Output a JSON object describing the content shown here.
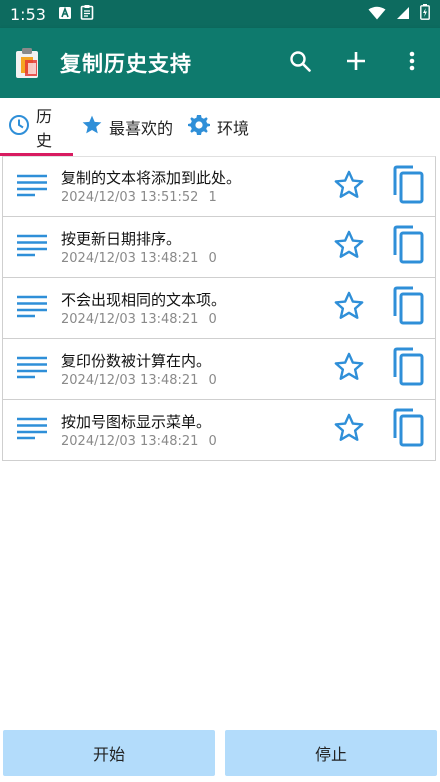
{
  "status_bar": {
    "time": "1:53",
    "left_icons": [
      "font-download-icon",
      "clipboard-icon"
    ],
    "right_icons": [
      "wifi-icon",
      "signal-icon",
      "battery-icon"
    ]
  },
  "app_bar": {
    "title": "复制历史支持",
    "actions": [
      "search-icon",
      "add-icon",
      "more-vert-icon"
    ]
  },
  "tabs": [
    {
      "label": "历史",
      "icon": "clock-icon",
      "active": true
    },
    {
      "label": "最喜欢的",
      "icon": "star-icon",
      "active": false
    },
    {
      "label": "环境",
      "icon": "gear-icon",
      "active": false
    }
  ],
  "items": [
    {
      "title": "复制的文本将添加到此处。",
      "date": "2024/12/03 13:51:52",
      "count": "1"
    },
    {
      "title": "按更新日期排序。",
      "date": "2024/12/03 13:48:21",
      "count": "0"
    },
    {
      "title": "不会出现相同的文本项。",
      "date": "2024/12/03 13:48:21",
      "count": "0"
    },
    {
      "title": "复印份数被计算在内。",
      "date": "2024/12/03 13:48:21",
      "count": "0"
    },
    {
      "title": "按加号图标显示菜单。",
      "date": "2024/12/03 13:48:21",
      "count": "0"
    }
  ],
  "bottom_buttons": {
    "start": "开始",
    "stop": "停止"
  },
  "colors": {
    "status_bar": "#0d6b5f",
    "app_bar": "#0e7a6d",
    "accent_blue": "#2f8fd8",
    "tab_indicator": "#d81b60",
    "button_bg": "#b3dcfb"
  }
}
